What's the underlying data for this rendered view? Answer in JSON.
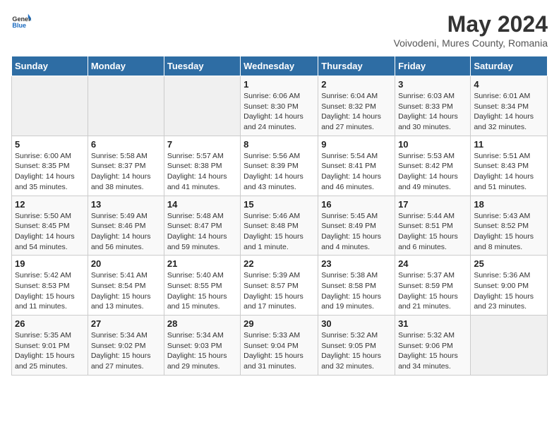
{
  "logo": {
    "general": "General",
    "blue": "Blue"
  },
  "title": "May 2024",
  "subtitle": "Voivodeni, Mures County, Romania",
  "days_of_week": [
    "Sunday",
    "Monday",
    "Tuesday",
    "Wednesday",
    "Thursday",
    "Friday",
    "Saturday"
  ],
  "weeks": [
    [
      {
        "day": "",
        "info": ""
      },
      {
        "day": "",
        "info": ""
      },
      {
        "day": "",
        "info": ""
      },
      {
        "day": "1",
        "info": "Sunrise: 6:06 AM\nSunset: 8:30 PM\nDaylight: 14 hours\nand 24 minutes."
      },
      {
        "day": "2",
        "info": "Sunrise: 6:04 AM\nSunset: 8:32 PM\nDaylight: 14 hours\nand 27 minutes."
      },
      {
        "day": "3",
        "info": "Sunrise: 6:03 AM\nSunset: 8:33 PM\nDaylight: 14 hours\nand 30 minutes."
      },
      {
        "day": "4",
        "info": "Sunrise: 6:01 AM\nSunset: 8:34 PM\nDaylight: 14 hours\nand 32 minutes."
      }
    ],
    [
      {
        "day": "5",
        "info": "Sunrise: 6:00 AM\nSunset: 8:35 PM\nDaylight: 14 hours\nand 35 minutes."
      },
      {
        "day": "6",
        "info": "Sunrise: 5:58 AM\nSunset: 8:37 PM\nDaylight: 14 hours\nand 38 minutes."
      },
      {
        "day": "7",
        "info": "Sunrise: 5:57 AM\nSunset: 8:38 PM\nDaylight: 14 hours\nand 41 minutes."
      },
      {
        "day": "8",
        "info": "Sunrise: 5:56 AM\nSunset: 8:39 PM\nDaylight: 14 hours\nand 43 minutes."
      },
      {
        "day": "9",
        "info": "Sunrise: 5:54 AM\nSunset: 8:41 PM\nDaylight: 14 hours\nand 46 minutes."
      },
      {
        "day": "10",
        "info": "Sunrise: 5:53 AM\nSunset: 8:42 PM\nDaylight: 14 hours\nand 49 minutes."
      },
      {
        "day": "11",
        "info": "Sunrise: 5:51 AM\nSunset: 8:43 PM\nDaylight: 14 hours\nand 51 minutes."
      }
    ],
    [
      {
        "day": "12",
        "info": "Sunrise: 5:50 AM\nSunset: 8:45 PM\nDaylight: 14 hours\nand 54 minutes."
      },
      {
        "day": "13",
        "info": "Sunrise: 5:49 AM\nSunset: 8:46 PM\nDaylight: 14 hours\nand 56 minutes."
      },
      {
        "day": "14",
        "info": "Sunrise: 5:48 AM\nSunset: 8:47 PM\nDaylight: 14 hours\nand 59 minutes."
      },
      {
        "day": "15",
        "info": "Sunrise: 5:46 AM\nSunset: 8:48 PM\nDaylight: 15 hours\nand 1 minute."
      },
      {
        "day": "16",
        "info": "Sunrise: 5:45 AM\nSunset: 8:49 PM\nDaylight: 15 hours\nand 4 minutes."
      },
      {
        "day": "17",
        "info": "Sunrise: 5:44 AM\nSunset: 8:51 PM\nDaylight: 15 hours\nand 6 minutes."
      },
      {
        "day": "18",
        "info": "Sunrise: 5:43 AM\nSunset: 8:52 PM\nDaylight: 15 hours\nand 8 minutes."
      }
    ],
    [
      {
        "day": "19",
        "info": "Sunrise: 5:42 AM\nSunset: 8:53 PM\nDaylight: 15 hours\nand 11 minutes."
      },
      {
        "day": "20",
        "info": "Sunrise: 5:41 AM\nSunset: 8:54 PM\nDaylight: 15 hours\nand 13 minutes."
      },
      {
        "day": "21",
        "info": "Sunrise: 5:40 AM\nSunset: 8:55 PM\nDaylight: 15 hours\nand 15 minutes."
      },
      {
        "day": "22",
        "info": "Sunrise: 5:39 AM\nSunset: 8:57 PM\nDaylight: 15 hours\nand 17 minutes."
      },
      {
        "day": "23",
        "info": "Sunrise: 5:38 AM\nSunset: 8:58 PM\nDaylight: 15 hours\nand 19 minutes."
      },
      {
        "day": "24",
        "info": "Sunrise: 5:37 AM\nSunset: 8:59 PM\nDaylight: 15 hours\nand 21 minutes."
      },
      {
        "day": "25",
        "info": "Sunrise: 5:36 AM\nSunset: 9:00 PM\nDaylight: 15 hours\nand 23 minutes."
      }
    ],
    [
      {
        "day": "26",
        "info": "Sunrise: 5:35 AM\nSunset: 9:01 PM\nDaylight: 15 hours\nand 25 minutes."
      },
      {
        "day": "27",
        "info": "Sunrise: 5:34 AM\nSunset: 9:02 PM\nDaylight: 15 hours\nand 27 minutes."
      },
      {
        "day": "28",
        "info": "Sunrise: 5:34 AM\nSunset: 9:03 PM\nDaylight: 15 hours\nand 29 minutes."
      },
      {
        "day": "29",
        "info": "Sunrise: 5:33 AM\nSunset: 9:04 PM\nDaylight: 15 hours\nand 31 minutes."
      },
      {
        "day": "30",
        "info": "Sunrise: 5:32 AM\nSunset: 9:05 PM\nDaylight: 15 hours\nand 32 minutes."
      },
      {
        "day": "31",
        "info": "Sunrise: 5:32 AM\nSunset: 9:06 PM\nDaylight: 15 hours\nand 34 minutes."
      },
      {
        "day": "",
        "info": ""
      }
    ]
  ]
}
